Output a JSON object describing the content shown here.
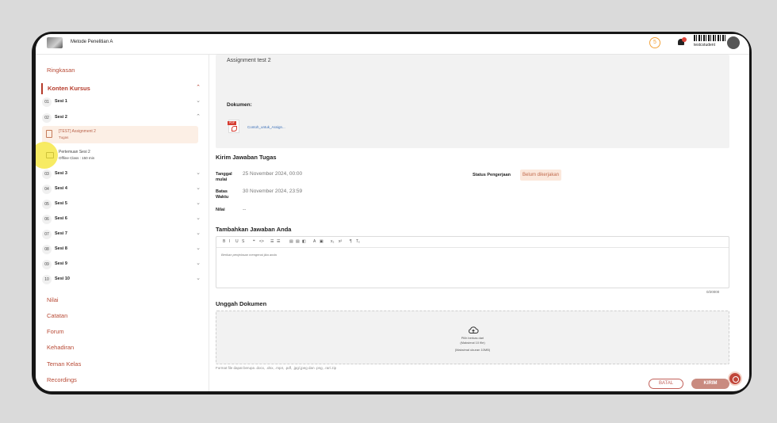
{
  "header": {
    "course_title": "Metode Penelitian A",
    "badge": "5",
    "username": "testcstudent"
  },
  "sidebar": {
    "ringkasan": "Ringkasan",
    "konten_kursus": "Konten Kursus",
    "sessions": [
      {
        "num": "01",
        "label": "Sesi 1"
      },
      {
        "num": "02",
        "label": "Sesi 2"
      },
      {
        "num": "03",
        "label": "Sesi 3"
      },
      {
        "num": "04",
        "label": "Sesi 4"
      },
      {
        "num": "05",
        "label": "Sesi 5"
      },
      {
        "num": "06",
        "label": "Sesi 6"
      },
      {
        "num": "07",
        "label": "Sesi 7"
      },
      {
        "num": "08",
        "label": "Sesi 8"
      },
      {
        "num": "09",
        "label": "Sesi 9"
      },
      {
        "num": "10",
        "label": "Sesi 10"
      }
    ],
    "sub_items": [
      {
        "title": "[TEST] Assignment 2",
        "meta": "Tugas"
      },
      {
        "title": "Pertemuan Sesi 2",
        "meta": "Offline Class : 150 min"
      }
    ],
    "links": [
      "Nilai",
      "Catatan",
      "Forum",
      "Kehadiran",
      "Teman Kelas",
      "Recordings"
    ]
  },
  "main": {
    "description": "Assignment test 2",
    "document_label": "Dokumen:",
    "pdf_tag": "PDF",
    "document_file": "Contoh_untuk_Assign...",
    "submit_title": "Kirim Jawaban Tugas",
    "start_label": "Tanggal mulai",
    "start_value": "25 November 2024, 00:00",
    "deadline_label": "Batas Waktu",
    "deadline_value": "30 November 2024, 23:59",
    "score_label": "Nilai",
    "score_value": "--",
    "status_label": "Status Pengerjaan",
    "status_value": "Belum dikerjakan",
    "answer_title": "Tambahkan Jawaban Anda",
    "toolbar": [
      "B",
      "I",
      "U",
      "S",
      "❝",
      "<>",
      "☰",
      "☰",
      "▤",
      "▤",
      "◧",
      "A",
      "▣",
      "x₂",
      "x²",
      "¶",
      "Tₓ"
    ],
    "editor_placeholder": "Berikan penjelasan mengenai jika anda",
    "char_count": "0/20000",
    "upload_title": "Unggah Dokumen",
    "upload_line1": "Pilih berkas dari",
    "upload_line2": "(Maksimal 10 file)",
    "upload_line3": "(Maksimal ukuran 10MB)",
    "format_note": "Format file dapat berupa .docx, .xlsx, .mp4, .pdf, .jpg/.jpeg dan .png, .rar/.zip",
    "btn_cancel": "BATAL",
    "btn_submit": "KIRIM"
  }
}
